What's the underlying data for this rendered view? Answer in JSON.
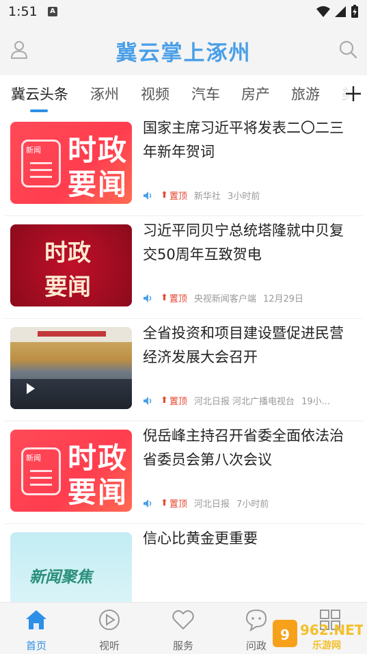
{
  "status_bar": {
    "time": "1:51",
    "notification_icon": "A"
  },
  "header": {
    "title": "冀云掌上涿州"
  },
  "tabs": [
    {
      "label": "冀云头条",
      "active": true
    },
    {
      "label": "涿州"
    },
    {
      "label": "视频"
    },
    {
      "label": "汽车"
    },
    {
      "label": "房产"
    },
    {
      "label": "旅游"
    },
    {
      "label": "美"
    }
  ],
  "feed": [
    {
      "title": "国家主席习近平将发表二〇二三年新年贺词",
      "pin_label": "置顶",
      "source": "新华社",
      "time": "3小时前",
      "thumb": {
        "type": "red",
        "chars": [
          "时",
          "政",
          "要",
          "闻"
        ],
        "badge": "新闻"
      }
    },
    {
      "title": "习近平同贝宁总统塔隆就中贝复交50周年互致贺电",
      "pin_label": "置顶",
      "source": "央视新闻客户端",
      "time": "12月29日",
      "thumb": {
        "type": "dark",
        "chars": [
          "时政",
          "要闻"
        ]
      }
    },
    {
      "title": "全省投资和项目建设暨促进民营经济发展大会召开",
      "pin_label": "置顶",
      "source": "河北日报 河北广播电视台",
      "time": "19小...",
      "thumb": {
        "type": "photo"
      }
    },
    {
      "title": "倪岳峰主持召开省委全面依法治省委员会第八次会议",
      "pin_label": "置顶",
      "source": "河北日报",
      "time": "7小时前",
      "thumb": {
        "type": "red",
        "chars": [
          "时",
          "政",
          "要",
          "闻"
        ],
        "badge": "新闻"
      }
    },
    {
      "title": "信心比黄金更重要",
      "thumb": {
        "type": "teal",
        "chars": "新闻聚焦"
      }
    }
  ],
  "bottom_nav": [
    {
      "label": "首页",
      "icon": "home-icon",
      "active": true
    },
    {
      "label": "视听",
      "icon": "play-circle-icon"
    },
    {
      "label": "服务",
      "icon": "heart-icon"
    },
    {
      "label": "问政",
      "icon": "chat-icon"
    },
    {
      "label": "",
      "icon": "grid-icon"
    }
  ],
  "watermark": {
    "text": "962.NET",
    "subtext": "乐游网"
  },
  "colors": {
    "accent": "#2e8fe6",
    "title_blue": "#4a9fe8",
    "pin_red": "#e5462f"
  }
}
